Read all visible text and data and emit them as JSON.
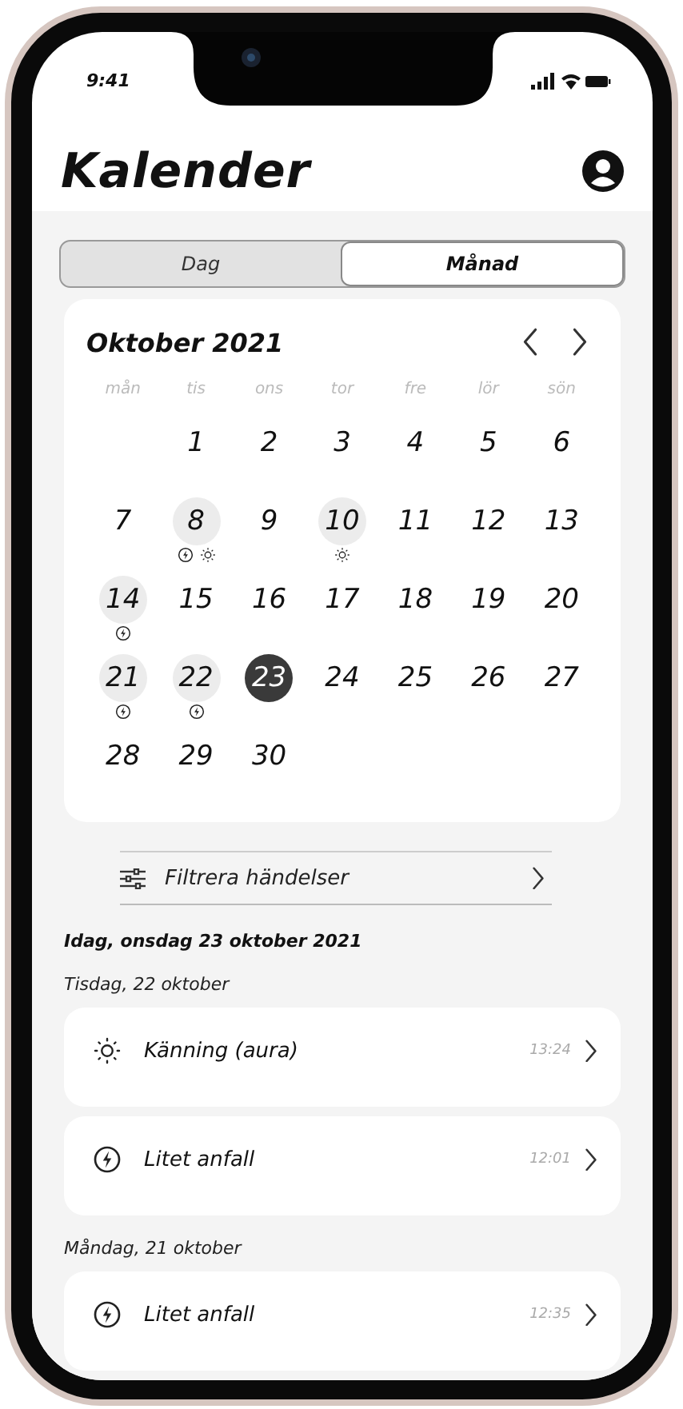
{
  "status_bar": {
    "time": "9:41"
  },
  "header": {
    "title": "Kalender"
  },
  "view_tabs": [
    {
      "label": "Dag",
      "selected": false
    },
    {
      "label": "Månad",
      "selected": true
    }
  ],
  "calendar": {
    "title": "Oktober 2021",
    "weekdays": [
      "mån",
      "tis",
      "ons",
      "tor",
      "fre",
      "lör",
      "sön"
    ],
    "days": [
      {
        "kind": "empty"
      },
      {
        "kind": "day",
        "day": "1",
        "selected": false
      },
      {
        "kind": "day",
        "day": "2",
        "selected": false
      },
      {
        "kind": "day",
        "day": "3",
        "selected": false
      },
      {
        "kind": "day",
        "day": "4",
        "selected": false
      },
      {
        "kind": "day",
        "day": "5",
        "selected": false
      },
      {
        "kind": "day",
        "day": "6",
        "selected": false
      },
      {
        "kind": "day",
        "day": "7",
        "selected": false
      },
      {
        "kind": "day",
        "day": "8",
        "selected": false,
        "events": [
          {
            "kind": "seizure"
          },
          {
            "kind": "aura"
          }
        ]
      },
      {
        "kind": "day",
        "day": "9",
        "selected": false
      },
      {
        "kind": "day",
        "day": "10",
        "selected": false,
        "events": [
          {
            "kind": "aura"
          }
        ]
      },
      {
        "kind": "day",
        "day": "11",
        "selected": false
      },
      {
        "kind": "day",
        "day": "12",
        "selected": false
      },
      {
        "kind": "day",
        "day": "13",
        "selected": false
      },
      {
        "kind": "day",
        "day": "14",
        "selected": false,
        "events": [
          {
            "kind": "seizure"
          }
        ]
      },
      {
        "kind": "day",
        "day": "15",
        "selected": false
      },
      {
        "kind": "day",
        "day": "16",
        "selected": false
      },
      {
        "kind": "day",
        "day": "17",
        "selected": false
      },
      {
        "kind": "day",
        "day": "18",
        "selected": false
      },
      {
        "kind": "day",
        "day": "19",
        "selected": false
      },
      {
        "kind": "day",
        "day": "20",
        "selected": false
      },
      {
        "kind": "day",
        "day": "21",
        "selected": false,
        "events": [
          {
            "kind": "seizure"
          }
        ]
      },
      {
        "kind": "day",
        "day": "22",
        "selected": false,
        "events": [
          {
            "kind": "seizure"
          }
        ]
      },
      {
        "kind": "day",
        "day": "23",
        "selected": true
      },
      {
        "kind": "day",
        "day": "24",
        "selected": false
      },
      {
        "kind": "day",
        "day": "25",
        "selected": false
      },
      {
        "kind": "day",
        "day": "26",
        "selected": false
      },
      {
        "kind": "day",
        "day": "27",
        "selected": false
      },
      {
        "kind": "day",
        "day": "28",
        "selected": false
      },
      {
        "kind": "day",
        "day": "29",
        "selected": false
      },
      {
        "kind": "day",
        "day": "30",
        "selected": false
      }
    ]
  },
  "filter": {
    "label": "Filtrera händelser"
  },
  "today_heading": "Idag, onsdag 23 oktober 2021",
  "groups": [
    {
      "date": "Tisdag, 22 oktober",
      "events": [
        {
          "kind": "aura",
          "title": "Känning (aura)",
          "time": "13:24"
        },
        {
          "kind": "seizure",
          "title": "Litet anfall",
          "time": "12:01"
        }
      ]
    },
    {
      "date": "Måndag, 21 oktober",
      "events": [
        {
          "kind": "seizure",
          "title": "Litet anfall",
          "time": "12:35"
        }
      ]
    }
  ]
}
